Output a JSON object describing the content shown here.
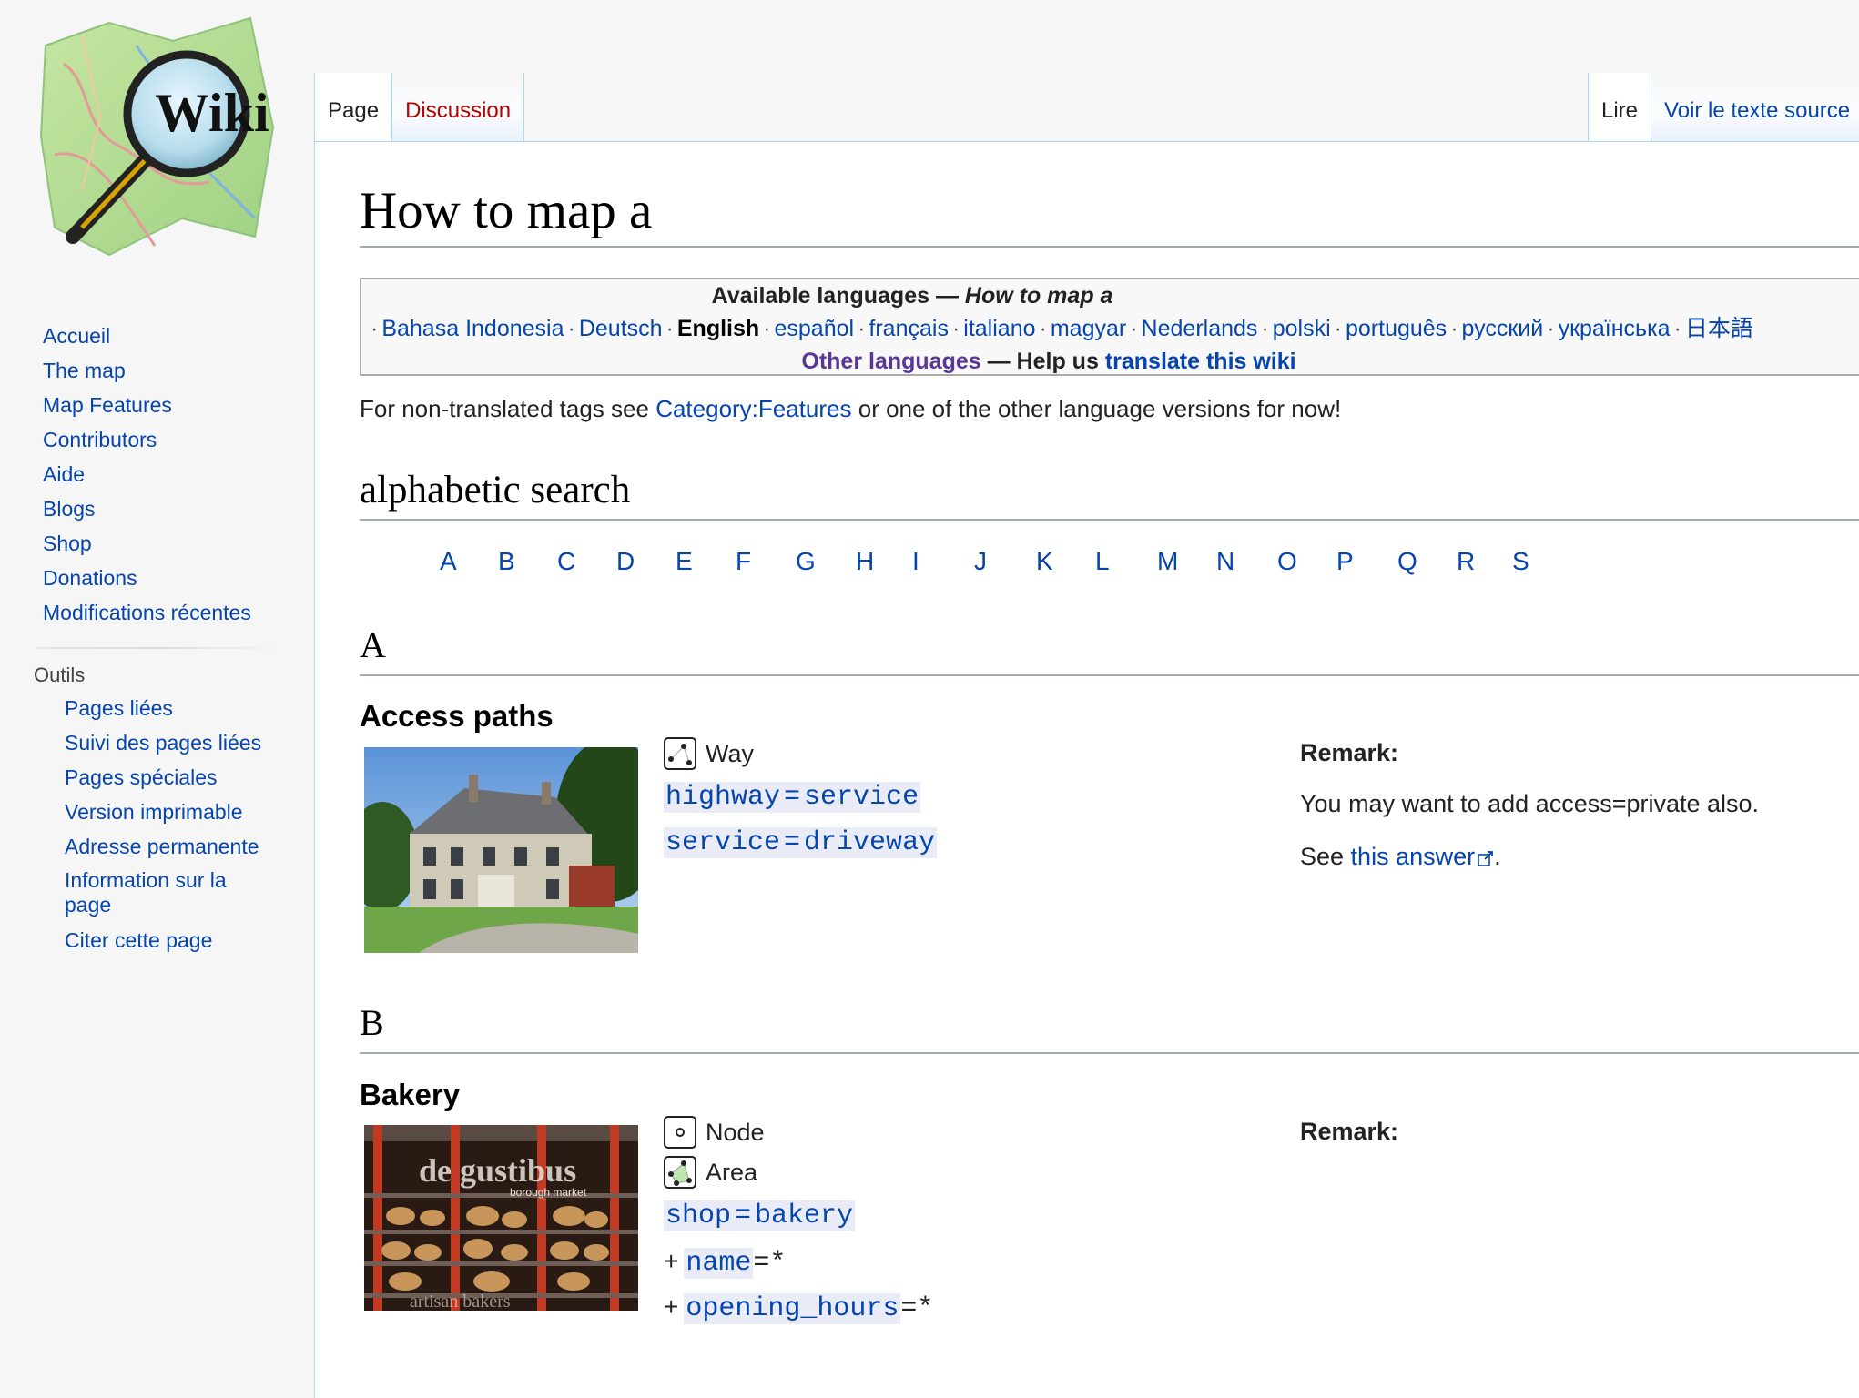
{
  "logo": {
    "label": "Wiki"
  },
  "tabs": {
    "left": [
      {
        "label": "Page",
        "selected": true
      },
      {
        "label": "Discussion",
        "selected": false
      }
    ],
    "right": [
      {
        "label": "Lire",
        "selected": true
      },
      {
        "label": "Voir le texte source",
        "selected": false
      }
    ]
  },
  "sidebar": {
    "nav": [
      "Accueil",
      "The map",
      "Map Features",
      "Contributors",
      "Aide",
      "Blogs",
      "Shop",
      "Donations",
      "Modifications récentes"
    ],
    "tools_heading": "Outils",
    "tools": [
      "Pages liées",
      "Suivi des pages liées",
      "Pages spéciales",
      "Version imprimable",
      "Adresse permanente",
      "Information sur la page",
      "Citer cette page"
    ]
  },
  "page": {
    "title": "How to map a",
    "languages": {
      "heading": "Available languages",
      "heading_dash": " — ",
      "heading_page": "How to map a",
      "list": [
        "Bahasa Indonesia",
        "Deutsch",
        "English",
        "español",
        "français",
        "italiano",
        "magyar",
        "Nederlands",
        "polski",
        "português",
        "русский",
        "українська",
        "日本語"
      ],
      "current": "English",
      "other": "Other languages",
      "dash": " — ",
      "help": "Help us ",
      "translate": "translate this wiki"
    },
    "intro": {
      "before": "For non-translated tags see ",
      "link": "Category:Features",
      "after": " or one of the other language versions for now!"
    },
    "alpha_heading": "alphabetic search",
    "letters": [
      "A",
      "B",
      "C",
      "D",
      "E",
      "F",
      "G",
      "H",
      "I",
      "J",
      "K",
      "L",
      "M",
      "N",
      "O",
      "P",
      "Q",
      "R",
      "S"
    ],
    "sections": [
      {
        "letter": "A",
        "feature": "Access paths",
        "kinds": [
          "Way"
        ],
        "tags": [
          {
            "key": "highway",
            "value": "service",
            "plus": false
          },
          {
            "key": "service",
            "value": "driveway",
            "plus": false
          }
        ],
        "remark_label": "Remark:",
        "remark_text": "You may want to add access=private also.",
        "see_prefix": "See ",
        "see_link": "this answer",
        "see_suffix": "."
      },
      {
        "letter": "B",
        "feature": "Bakery",
        "kinds": [
          "Node",
          "Area"
        ],
        "tags": [
          {
            "key": "shop",
            "value": "bakery",
            "plus": false
          },
          {
            "key": "name",
            "value": "*",
            "plus": true
          },
          {
            "key": "opening_hours",
            "value": "*",
            "plus": true
          }
        ],
        "remark_label": "Remark:",
        "photo_sign": "de gustibus",
        "photo_sub": "borough market",
        "photo_bottom": "artisan bakers"
      }
    ]
  }
}
